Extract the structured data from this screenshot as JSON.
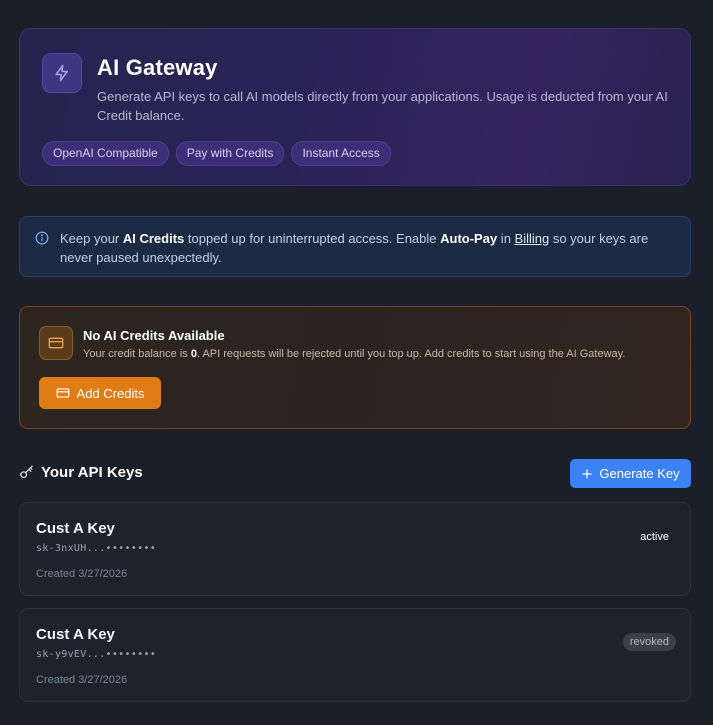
{
  "hero": {
    "title": "AI Gateway",
    "description": "Generate API keys to call AI models directly from your applications. Usage is deducted from your AI Credit balance.",
    "chips": [
      "OpenAI Compatible",
      "Pay with Credits",
      "Instant Access"
    ],
    "icon": "lightning-icon"
  },
  "info_banner": {
    "icon": "info-icon",
    "text_1": "Keep your ",
    "bold_1": "AI Credits",
    "text_2": " topped up for uninterrupted access. Enable ",
    "bold_2": "Auto-Pay",
    "text_3": " in ",
    "link": "Billing",
    "text_4": " so your keys are never paused unexpectedly."
  },
  "warning": {
    "icon": "credit-card-icon",
    "title": "No AI Credits Available",
    "desc_1": "Your credit balance is ",
    "balance": "0",
    "desc_2": ". API requests will be rejected until you top up. Add credits to start using the AI Gateway.",
    "button_label": "Add Credits"
  },
  "keys_section": {
    "title": "Your API Keys",
    "generate_label": "Generate Key",
    "keys": [
      {
        "name": "Cust A Key",
        "value": "sk-3nxUH...••••••••",
        "created": "Created 3/27/2026",
        "status": "active"
      },
      {
        "name": "Cust A Key",
        "value": "sk-y9vEV...••••••••",
        "created": "Created 3/27/2026",
        "status": "revoked"
      }
    ]
  },
  "colors": {
    "accent_blue": "#3b82f6",
    "accent_orange": "#e07c14",
    "hero_purple": "#2b2359"
  }
}
